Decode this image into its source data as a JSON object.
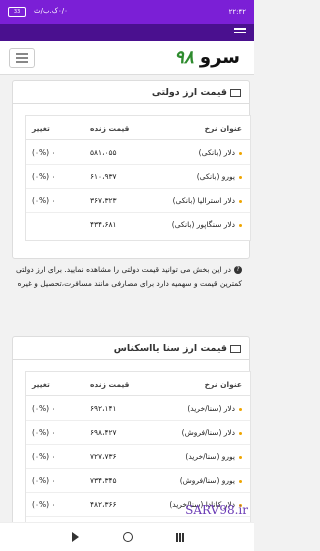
{
  "status": {
    "time": "۲۲:۴۲",
    "network": "۰/۰ک.ب/ث",
    "battery": "33"
  },
  "header": {
    "logo_text": "سرو",
    "logo_number": "۹۸"
  },
  "government": {
    "title": "قیمت ارز دولتی",
    "columns": {
      "name": "عنوان نرخ",
      "price": "قیمت زنده",
      "change": "تغییر"
    },
    "rows": [
      {
        "name": "دلار (بانکی)",
        "price": "۵۸۱،۰۵۵",
        "change": "۰ (۰%)"
      },
      {
        "name": "یورو (بانکی)",
        "price": "۶۱۰،۹۳۷",
        "change": "۰ (۰%)"
      },
      {
        "name": "دلار استرالیا (بانکی)",
        "price": "۳۶۷،۳۲۳",
        "change": "۰ (۰%)"
      },
      {
        "name": "دلار سنگاپور (بانکی)",
        "price": "۴۳۴،۶۸۱",
        "change": ""
      }
    ]
  },
  "note": "در این بخش می توانید قیمت دولتی را مشاهده نمایید. برای ارز دولتی کمترین قیمت و سهمیه دارد برای مصارفی مانند مسافرت،تحصیل و غیره",
  "sana": {
    "title": "قیمت ارز سنا یااسکناس",
    "columns": {
      "name": "عنوان نرخ",
      "price": "قیمت زنده",
      "change": "تغییر"
    },
    "rows": [
      {
        "name": "دلار (سنا/خرید)",
        "price": "۶۹۲،۱۴۱",
        "change": "۰ (۰%)"
      },
      {
        "name": "دلار (سنا/فروش)",
        "price": "۶۹۸،۴۲۷",
        "change": "۰ (۰%)"
      },
      {
        "name": "یورو (سنا/خرید)",
        "price": "۷۲۷،۷۳۶",
        "change": "۰ (۰%)"
      },
      {
        "name": "یورو (سنا/فروش)",
        "price": "۷۳۴،۳۴۵",
        "change": "۰ (۰%)"
      },
      {
        "name": "دلار کانادا (سنا/خرید)",
        "price": "۴۸۲،۳۶۶",
        "change": "۰ (۰%)"
      }
    ]
  },
  "watermark": "SARV98.ir"
}
